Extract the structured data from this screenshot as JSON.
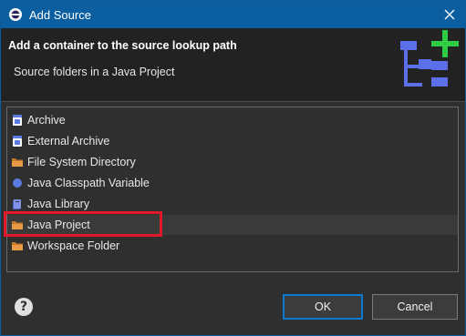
{
  "window": {
    "title": "Add Source"
  },
  "header": {
    "title": "Add a container to the source lookup path",
    "message": "Source folders in a Java Project"
  },
  "list": {
    "items": [
      {
        "label": "Archive",
        "icon": "jar-icon"
      },
      {
        "label": "External Archive",
        "icon": "jar-icon"
      },
      {
        "label": "File System Directory",
        "icon": "folder-icon"
      },
      {
        "label": "Java Classpath Variable",
        "icon": "blue-dot-icon"
      },
      {
        "label": "Java Library",
        "icon": "library-icon"
      },
      {
        "label": "Java Project",
        "icon": "folder-icon"
      },
      {
        "label": "Workspace Folder",
        "icon": "folder-icon"
      }
    ],
    "selected_label": "Java Project"
  },
  "buttons": {
    "ok": "OK",
    "cancel": "Cancel"
  },
  "colors": {
    "accent": "#0b5e9f",
    "highlight": "#e0182a"
  }
}
